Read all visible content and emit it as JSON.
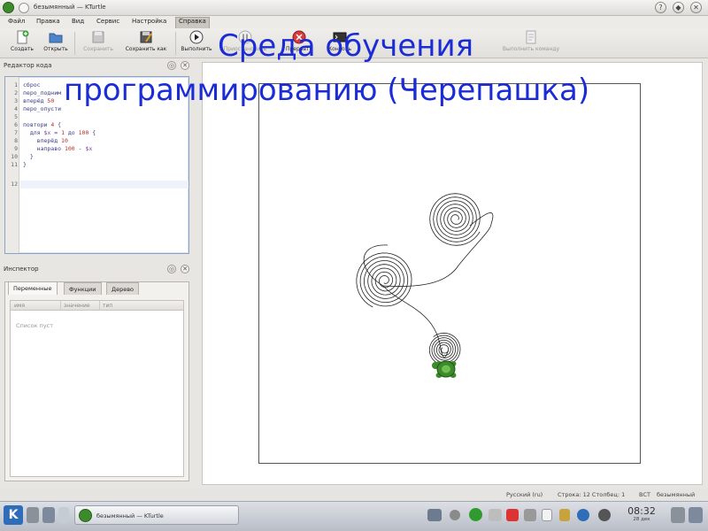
{
  "window": {
    "title": "безымянный — KTurtle",
    "controls": [
      "?",
      "◆",
      "✕"
    ]
  },
  "menu": [
    "Файл",
    "Правка",
    "Вид",
    "Сервис",
    "Настройка",
    "Справка"
  ],
  "toolbar": {
    "create": "Создать",
    "open": "Открыть",
    "save": "Сохранить",
    "save_as": "Сохранить как",
    "run": "Выполнить",
    "step": "Приостановить",
    "abort": "Прервать",
    "console": "Консоль",
    "execute_command": "Выполнить команду"
  },
  "editor": {
    "title": "Редактор кода",
    "line_numbers": [
      "1",
      "2",
      "3",
      "4",
      "5",
      "6",
      "7",
      "8",
      "9",
      "10",
      "11",
      "12"
    ],
    "lines": [
      "сброс",
      "перо_подним",
      "вперёд 50",
      "перо_опусти",
      "",
      "повтори 4 {",
      "  для $x = 1 до 100 {",
      "    вперёд 10",
      "    направо 100 - $x",
      "  }",
      "}",
      ""
    ]
  },
  "inspector": {
    "title": "Инспектор",
    "tabs": [
      "Переменные",
      "Функции",
      "Дерево"
    ],
    "columns": [
      "имя",
      "значение",
      "тип"
    ],
    "empty": "Список пуст"
  },
  "overlay": {
    "line1": "Среда обучения",
    "line2": "программированию (Черепашка)"
  },
  "status": {
    "language": "Русский (ru)",
    "position": "Строка: 12 Столбец: 1",
    "mode": "ВСТ",
    "file": "безымянный"
  },
  "taskbar": {
    "task": "безымянный — KTurtle",
    "time": "08:32",
    "date": "28 дек"
  },
  "colors": {
    "overlay": "#1b2bd6",
    "turtle": "#3d8a2c"
  }
}
